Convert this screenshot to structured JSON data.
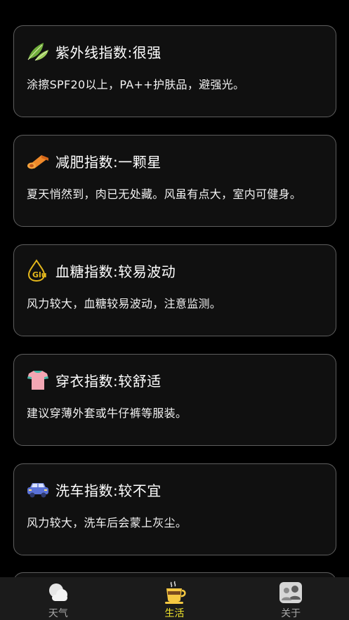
{
  "cards": [
    {
      "icon": "leaf-icon",
      "title": "紫外线指数:很强",
      "description": "涂擦SPF20以上，PA++护肤品，避强光。"
    },
    {
      "icon": "yoga-mat-icon",
      "title": "减肥指数:一颗星",
      "description": "夏天悄然到，肉已无处藏。风虽有点大，室内可健身。"
    },
    {
      "icon": "glucose-drop-icon",
      "title": "血糖指数:较易波动",
      "description": "风力较大，血糖较易波动，注意监测。"
    },
    {
      "icon": "tshirt-icon",
      "title": "穿衣指数:较舒适",
      "description": "建议穿薄外套或牛仔裤等服装。"
    },
    {
      "icon": "car-icon",
      "title": "洗车指数:较不宜",
      "description": "风力较大，洗车后会蒙上灰尘。"
    }
  ],
  "tabbar": {
    "tabs": [
      {
        "label": "天气",
        "icon": "cloud-icon"
      },
      {
        "label": "生活",
        "icon": "coffee-cup-icon"
      },
      {
        "label": "关于",
        "icon": "people-icon"
      }
    ],
    "active_tab": "生活",
    "active_color": "#f1e52b",
    "inactive_color": "#a8a8a8"
  }
}
